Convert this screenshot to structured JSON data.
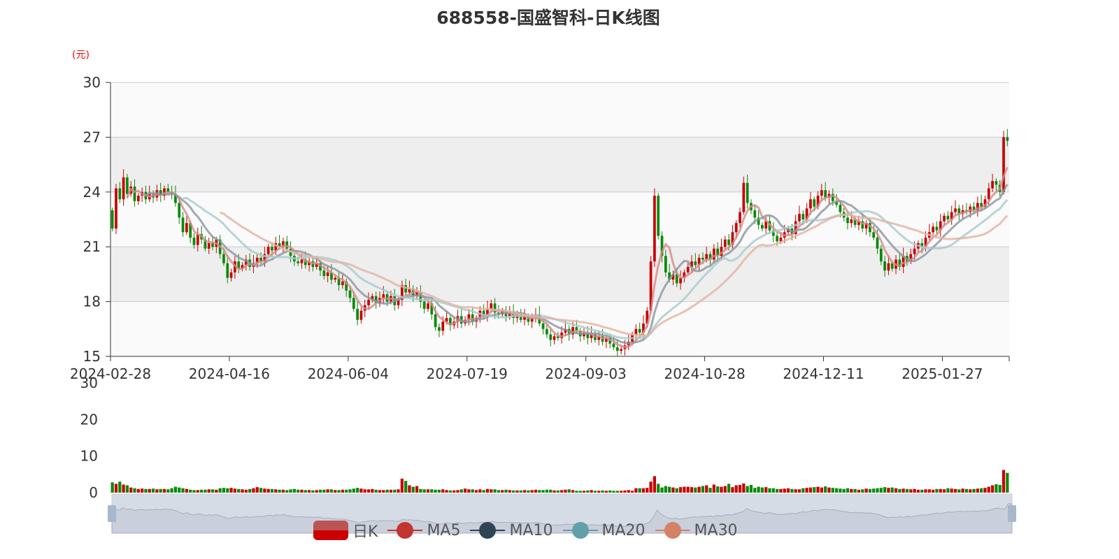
{
  "title": "688558-国盛智科-日K线图",
  "unit_label": "(元)",
  "colors": {
    "up": "#c80000",
    "down": "#0a8a0a",
    "ma5": "#d78a8a",
    "ma10": "#8a959f",
    "ma20": "#a8cacc",
    "ma30": "#e2b3a3"
  },
  "legend": [
    {
      "label": "日K",
      "color": "#c00000"
    },
    {
      "label": "MA5",
      "color": "#c23531"
    },
    {
      "label": "MA10",
      "color": "#2f4554"
    },
    {
      "label": "MA20",
      "color": "#61a0a8"
    },
    {
      "label": "MA30",
      "color": "#d48265"
    }
  ],
  "chart_data": {
    "type": "candlestick",
    "title": "688558-国盛智科-日K线图",
    "ylabel": "(元)",
    "price_ylim": [
      15,
      30
    ],
    "price_ticks": [
      "15",
      "18",
      "21",
      "24",
      "27",
      "30"
    ],
    "volume_ylim": [
      0,
      30
    ],
    "volume_ticks": [
      "0",
      "10",
      "20",
      "30"
    ],
    "x_labels": [
      {
        "index": 0,
        "label": "2024-02-28"
      },
      {
        "index": 32,
        "label": "2024-04-16"
      },
      {
        "index": 64,
        "label": "2024-06-04"
      },
      {
        "index": 96,
        "label": "2024-07-19"
      },
      {
        "index": 128,
        "label": "2024-09-03"
      },
      {
        "index": 160,
        "label": "2024-10-28"
      },
      {
        "index": 192,
        "label": "2024-12-11"
      },
      {
        "index": 224,
        "label": "2025-01-27"
      }
    ],
    "first_open": 23.0,
    "close": [
      22.0,
      24.2,
      23.6,
      24.8,
      23.9,
      24.3,
      23.5,
      23.8,
      24.0,
      23.6,
      23.9,
      23.7,
      24.1,
      23.8,
      24.2,
      24.0,
      23.9,
      23.4,
      22.6,
      21.8,
      22.3,
      21.5,
      21.1,
      21.7,
      21.4,
      20.9,
      21.2,
      21.0,
      21.4,
      20.6,
      20.1,
      19.3,
      19.6,
      20.2,
      19.8,
      20.0,
      20.3,
      19.9,
      20.1,
      20.4,
      20.2,
      20.6,
      21.0,
      20.8,
      21.2,
      21.0,
      21.3,
      20.9,
      20.5,
      20.2,
      20.1,
      20.3,
      20.0,
      20.2,
      19.9,
      20.1,
      19.7,
      19.4,
      19.6,
      19.2,
      19.3,
      18.9,
      19.1,
      18.6,
      18.2,
      17.6,
      17.0,
      17.5,
      17.8,
      18.1,
      18.3,
      17.9,
      18.2,
      18.4,
      18.0,
      18.3,
      17.8,
      18.1,
      18.9,
      18.5,
      18.7,
      18.3,
      18.5,
      18.0,
      17.6,
      17.9,
      17.3,
      16.6,
      16.4,
      16.9,
      17.1,
      16.7,
      16.9,
      17.2,
      16.8,
      17.0,
      17.3,
      16.9,
      17.1,
      17.5,
      17.2,
      17.6,
      17.9,
      17.4,
      17.3,
      17.5,
      17.2,
      17.4,
      17.1,
      17.3,
      17.0,
      17.2,
      16.9,
      17.1,
      17.3,
      16.8,
      16.5,
      16.2,
      15.9,
      16.1,
      16.0,
      16.3,
      16.5,
      16.2,
      16.6,
      16.4,
      16.1,
      16.3,
      16.0,
      16.2,
      15.9,
      16.1,
      15.8,
      16.0,
      15.7,
      15.5,
      15.3,
      15.4,
      15.6,
      15.8,
      16.2,
      16.5,
      16.3,
      16.8,
      17.5,
      20.2,
      23.8,
      21.6,
      20.5,
      19.6,
      19.2,
      19.5,
      19.0,
      19.3,
      19.6,
      19.9,
      20.2,
      20.0,
      20.4,
      20.3,
      20.6,
      20.3,
      20.9,
      20.5,
      21.0,
      21.4,
      21.1,
      21.8,
      22.3,
      22.9,
      24.5,
      23.4,
      23.0,
      22.6,
      22.2,
      22.0,
      22.4,
      21.9,
      21.6,
      21.3,
      21.5,
      21.8,
      22.0,
      21.7,
      22.4,
      22.8,
      22.5,
      23.1,
      23.6,
      23.2,
      23.8,
      24.1,
      23.7,
      23.9,
      23.5,
      23.3,
      22.9,
      22.6,
      22.3,
      22.5,
      22.2,
      22.4,
      22.0,
      22.3,
      21.8,
      21.5,
      20.9,
      20.2,
      19.7,
      20.1,
      19.8,
      20.3,
      19.9,
      20.5,
      20.2,
      20.6,
      20.9,
      21.2,
      21.0,
      21.5,
      21.8,
      22.1,
      21.9,
      22.4,
      22.7,
      22.5,
      22.9,
      23.1,
      22.8,
      23.0,
      22.9,
      23.2,
      23.0,
      23.4,
      23.2,
      23.6,
      24.2,
      24.6,
      24.4,
      24.0,
      27.0,
      26.8
    ],
    "volume": [
      2.8,
      2.4,
      3.0,
      2.2,
      2.0,
      1.4,
      1.2,
      1.0,
      1.1,
      1.0,
      1.0,
      1.1,
      0.9,
      1.0,
      1.0,
      0.9,
      1.2,
      1.6,
      1.4,
      1.2,
      1.0,
      0.8,
      0.7,
      0.7,
      0.8,
      0.8,
      0.9,
      0.9,
      0.8,
      1.2,
      1.3,
      1.2,
      1.3,
      1.1,
      1.0,
      0.9,
      0.8,
      1.0,
      1.2,
      1.5,
      1.3,
      1.1,
      1.0,
      1.0,
      0.9,
      0.8,
      0.8,
      0.7,
      0.9,
      1.0,
      0.8,
      0.8,
      0.7,
      0.7,
      0.6,
      0.7,
      0.8,
      0.8,
      0.9,
      0.9,
      0.7,
      0.7,
      0.8,
      0.8,
      0.9,
      1.1,
      1.3,
      1.1,
      0.9,
      0.9,
      1.0,
      0.8,
      0.7,
      0.7,
      0.8,
      0.8,
      0.8,
      0.9,
      3.8,
      3.2,
      2.0,
      1.6,
      1.8,
      1.0,
      0.9,
      0.9,
      0.9,
      0.8,
      0.8,
      0.9,
      0.7,
      0.6,
      0.6,
      0.7,
      0.9,
      1.1,
      0.9,
      0.9,
      0.7,
      0.9,
      0.7,
      1.0,
      0.9,
      0.9,
      0.7,
      0.7,
      0.8,
      0.7,
      0.6,
      0.6,
      0.6,
      0.7,
      0.6,
      0.7,
      0.8,
      0.7,
      0.7,
      0.8,
      0.8,
      0.6,
      0.6,
      0.7,
      0.8,
      0.9,
      0.7,
      0.5,
      0.5,
      0.5,
      0.6,
      0.7,
      0.5,
      0.5,
      0.6,
      0.5,
      0.6,
      0.5,
      0.5,
      0.5,
      0.6,
      0.7,
      0.5,
      1.2,
      1.2,
      1.2,
      1.3,
      3.0,
      4.5,
      2.4,
      1.4,
      1.8,
      1.6,
      1.4,
      1.2,
      1.5,
      1.6,
      1.6,
      1.5,
      1.4,
      1.6,
      1.8,
      2.0,
      1.3,
      2.2,
      1.7,
      1.6,
      1.8,
      2.4,
      1.5,
      2.0,
      2.1,
      2.5,
      1.8,
      2.1,
      1.3,
      1.6,
      1.4,
      1.5,
      1.2,
      1.2,
      1.0,
      1.0,
      1.1,
      1.2,
      1.0,
      0.9,
      0.9,
      1.2,
      1.3,
      1.4,
      1.5,
      1.6,
      1.4,
      1.7,
      1.4,
      1.3,
      1.2,
      1.1,
      1.0,
      1.2,
      1.0,
      1.0,
      0.8,
      0.9,
      1.1,
      1.0,
      1.1,
      1.2,
      1.3,
      1.5,
      1.3,
      1.4,
      1.2,
      1.0,
      1.1,
      1.0,
      0.9,
      1.0,
      0.8,
      0.8,
      0.9,
      0.9,
      0.8,
      1.0,
      1.0,
      0.9,
      1.2,
      1.1,
      1.0,
      0.9,
      1.1,
      1.0,
      0.9,
      1.0,
      1.1,
      1.2,
      1.3,
      1.6,
      2.0,
      2.3,
      2.1,
      6.2,
      5.4
    ]
  }
}
